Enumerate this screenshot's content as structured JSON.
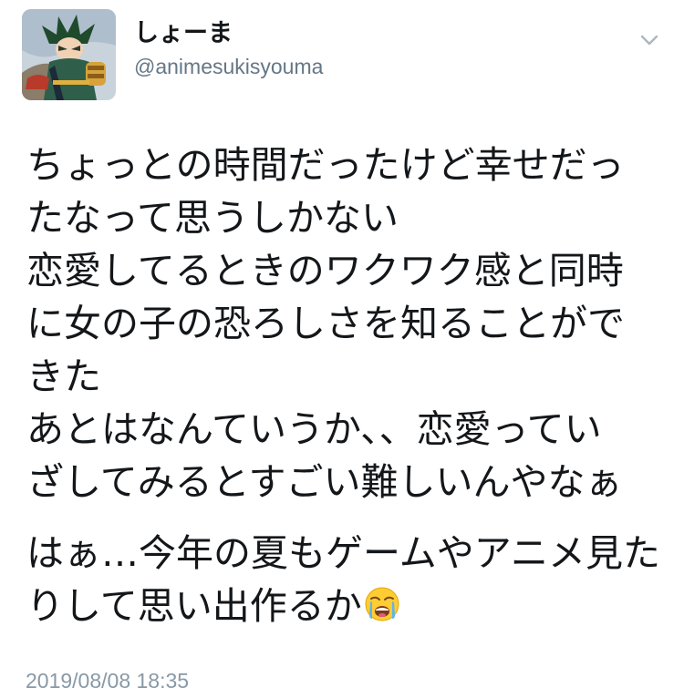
{
  "author": {
    "display_name": "しょーま",
    "handle": "@animesukisyouma",
    "avatar_icon": "anime-character-avatar"
  },
  "header": {
    "menu_icon": "chevron-down-icon"
  },
  "tweet": {
    "paragraph1": [
      "ちょっとの時間だったけど幸せだっ",
      "たなって思うしかない",
      "恋愛してるときのワクワク感と同時",
      "に女の子の恐ろしさを知ることがで",
      "きた",
      "あとはなんていうか、、恋愛ってい",
      "ざしてみるとすごい難しいんやなぁ"
    ],
    "paragraph2_line1": "はぁ…今年の夏もゲームやアニメ見た",
    "paragraph2_line2": "りして思い出作るか",
    "emoji_icon": "loudly-crying-face-icon"
  },
  "timestamp": "2019/08/08 18:35",
  "colors": {
    "text": "#14171a",
    "secondary": "#657786",
    "muted": "#8899a6"
  }
}
